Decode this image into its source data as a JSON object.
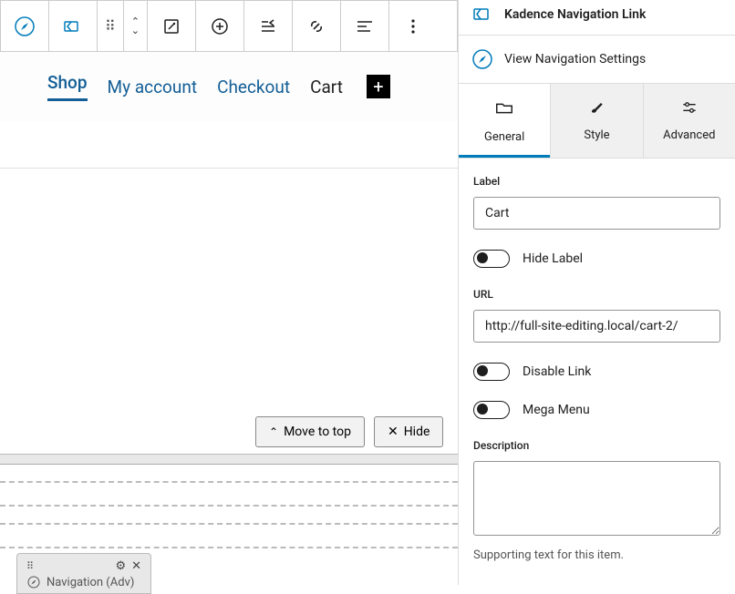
{
  "block": {
    "title": "Kadence Navigation Link",
    "view_settings": "View Navigation Settings"
  },
  "nav": {
    "items": [
      {
        "label": "Shop",
        "active": true
      },
      {
        "label": "My account"
      },
      {
        "label": "Checkout"
      },
      {
        "label": "Cart",
        "current": true
      }
    ]
  },
  "tabs": {
    "general": "General",
    "style": "Style",
    "advanced": "Advanced"
  },
  "panel": {
    "label_title": "Label",
    "label_value": "Cart",
    "hide_label": "Hide Label",
    "url_title": "URL",
    "url_value": "http://full-site-editing.local/cart-2/",
    "disable_link": "Disable Link",
    "mega_menu": "Mega Menu",
    "description_title": "Description",
    "description_value": "",
    "description_helper": "Supporting text for this item."
  },
  "floating": {
    "move_to_top": "Move to top",
    "hide": "Hide"
  },
  "breadcrumb": {
    "label": "Navigation (Adv)"
  }
}
